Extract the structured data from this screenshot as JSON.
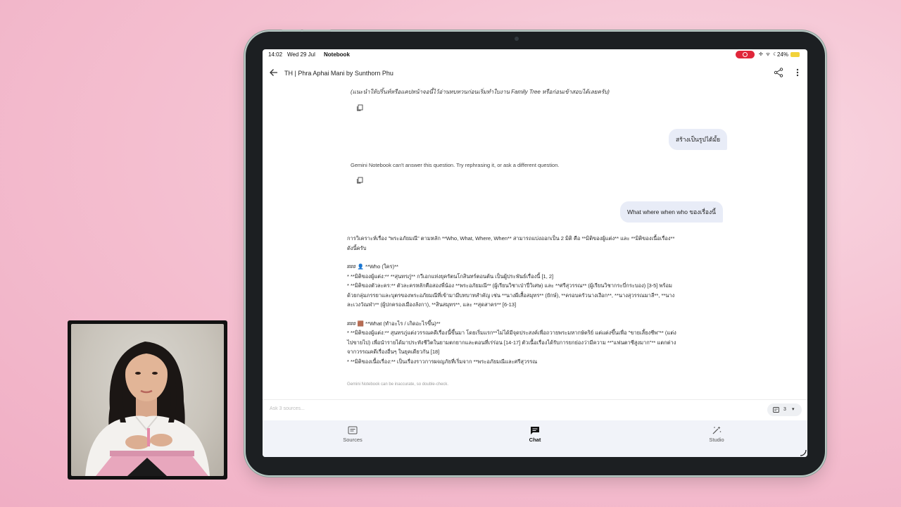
{
  "status_bar": {
    "time": "14:02",
    "date": "Wed 29 Jul",
    "app": "Notebook",
    "battery": "24%",
    "icons": "✢ ᯤ ☾"
  },
  "appbar": {
    "title": "TH | Phra Aphai Mani by Sunthorn Phu"
  },
  "chat": {
    "prev_response_tail": "(แนะนำให้ปริ้นท์หรือแคปหน้าจอนี้ไว้อ่านทบทวนก่อนเริ่มทำใบงาน Family Tree หรือก่อนเข้าสอบได้เลยครับ)",
    "user_msg_1": "สร้างเป็นรูปได้มั้ย",
    "system_msg": "Gemini Notebook can't answer this question. Try rephrasing it, or ask a different question.",
    "user_msg_2": "What where when who ของเรื่องนี้",
    "answer_lines": [
      "การวิเคราะห์เรื่อง \"พระอภัยมณี\" ตามหลัก **Who, What, Where, When** สามารถแบ่งออกเป็น 2 มิติ คือ **มิติของผู้แต่ง** และ **มิติของเนื้อเรื่อง**",
      "ดังนี้ครับ",
      "",
      "### 👤 **Who (ใคร)**",
      "*   **มิติของผู้แต่ง:** **สุนทรภู่** กวีเอกแห่งยุครัตนโกสินทร์ตอนต้น เป็นผู้ประพันธ์เรื่องนี้ [1, 2]",
      "*   **มิติของตัวละคร:** ตัวละครหลักคือสองพี่น้อง **พระอภัยมณี** (ผู้เรียนวิชาเป่าปี่วิเศษ) และ **ศรีสุวรรณ** (ผู้เรียนวิชากระบี่กระบอง) [3-5] พร้อม",
      "ด้วยกลุ่มภรรยาและบุตรของพระอภัยมณีที่เข้ามามีบทบาทสำคัญ เช่น **นางผีเสื้อสมุทร** (ยักษ์), **ครอบครัวนางเงือก**, **นางสุวรรณมาลี**, **นาง",
      "ละเวงวัณฬา** (ผู้ปกครองเมืองลังกา), **สินสมุทร**, และ **สุดสาคร** [6-13]",
      "",
      "### 🟫 **What (ทำอะไร / เกิดอะไรขึ้น)**",
      "*   **มิติของผู้แต่ง:** สุนทรภู่แต่งวรรณคดีเรื่องนี้ขึ้นมา โดยเริ่มแรก**ไม่ได้มีจุดประสงค์เพื่อถวายพระมหากษัตริย์ แต่แต่งขึ้นเพื่อ \"ขายเลี้ยงชีพ\"** (แต่ง",
      "ไปขายไป) เพื่อนำรายได้มาประทังชีวิตในยามตกยากและตอนที่เร่ร่อน [14-17] ตัวเนื้อเรื่องได้รับการยกย่องว่ามีความ **\"แฟนตาซีสูงมาก\"** แตกต่าง",
      "จากวรรณคดีเรื่องอื่นๆ ในยุคเดียวกัน [18]",
      "*   **มิติของเนื้อเรื่อง:** เป็นเรื่องราวการผจญภัยที่เริ่มจาก **พระอภัยมณีและศรีสุวรรณ"
    ],
    "disclaimer": "Gemini Notebook can be inaccurate, so double-check."
  },
  "input": {
    "placeholder": "Ask 3 sources...",
    "source_count": "3"
  },
  "bottom_nav": {
    "sources": "Sources",
    "chat": "Chat",
    "studio": "Studio"
  }
}
